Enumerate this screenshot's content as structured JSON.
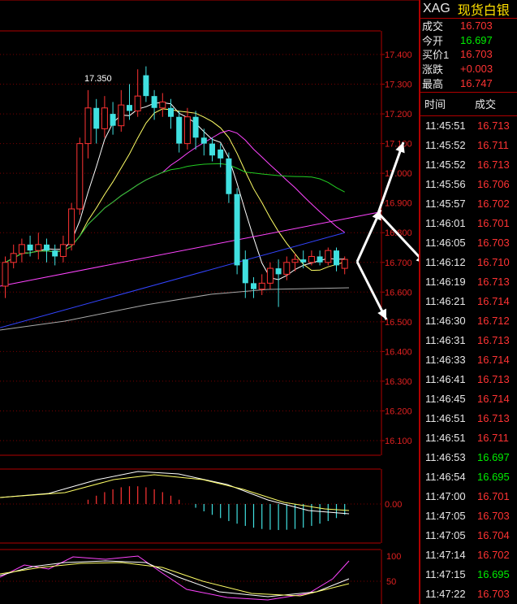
{
  "header": {
    "symbol": "XAG",
    "name": "现货白银"
  },
  "quote": [
    {
      "label": "成交",
      "value": "16.703",
      "color": "red"
    },
    {
      "label": "今开",
      "value": "16.697",
      "color": "green"
    },
    {
      "label": "买价1",
      "value": "16.703",
      "color": "red"
    },
    {
      "label": "涨跌",
      "value": "+0.003",
      "color": "red"
    },
    {
      "label": "最高",
      "value": "16.747",
      "color": "red"
    }
  ],
  "trades_header": {
    "time": "时间",
    "price": "成交"
  },
  "trades": [
    {
      "time": "11:45:51",
      "price": "16.713",
      "color": "red"
    },
    {
      "time": "11:45:52",
      "price": "16.711",
      "color": "red"
    },
    {
      "time": "11:45:52",
      "price": "16.713",
      "color": "red"
    },
    {
      "time": "11:45:56",
      "price": "16.706",
      "color": "red"
    },
    {
      "time": "11:45:57",
      "price": "16.702",
      "color": "red"
    },
    {
      "time": "11:46:01",
      "price": "16.701",
      "color": "red"
    },
    {
      "time": "11:46:05",
      "price": "16.703",
      "color": "red"
    },
    {
      "time": "11:46:12",
      "price": "16.710",
      "color": "red"
    },
    {
      "time": "11:46:19",
      "price": "16.713",
      "color": "red"
    },
    {
      "time": "11:46:21",
      "price": "16.714",
      "color": "red"
    },
    {
      "time": "11:46:30",
      "price": "16.712",
      "color": "red"
    },
    {
      "time": "11:46:31",
      "price": "16.713",
      "color": "red"
    },
    {
      "time": "11:46:33",
      "price": "16.714",
      "color": "red"
    },
    {
      "time": "11:46:41",
      "price": "16.713",
      "color": "red"
    },
    {
      "time": "11:46:45",
      "price": "16.714",
      "color": "red"
    },
    {
      "time": "11:46:51",
      "price": "16.713",
      "color": "red"
    },
    {
      "time": "11:46:51",
      "price": "16.711",
      "color": "red"
    },
    {
      "time": "11:46:53",
      "price": "16.697",
      "color": "green"
    },
    {
      "time": "11:46:54",
      "price": "16.695",
      "color": "green"
    },
    {
      "time": "11:47:00",
      "price": "16.701",
      "color": "red"
    },
    {
      "time": "11:47:05",
      "price": "16.703",
      "color": "red"
    },
    {
      "time": "11:47:05",
      "price": "16.704",
      "color": "red"
    },
    {
      "time": "11:47:14",
      "price": "16.702",
      "color": "red"
    },
    {
      "time": "11:47:15",
      "price": "16.695",
      "color": "green"
    },
    {
      "time": "11:47:22",
      "price": "16.703",
      "color": "red"
    }
  ],
  "chart_data": {
    "type": "candlestick",
    "price_axis": {
      "min": 16.1,
      "max": 17.4,
      "ticks": [
        "17.400",
        "17.300",
        "17.200",
        "17.100",
        "17.000",
        "16.900",
        "16.800",
        "16.700",
        "16.600",
        "16.500",
        "16.400",
        "16.300",
        "16.200",
        "16.100"
      ]
    },
    "high_annotation": "17.350",
    "candles": [
      {
        "o": 16.62,
        "c": 16.7,
        "h": 16.72,
        "l": 16.58
      },
      {
        "o": 16.7,
        "c": 16.73,
        "h": 16.76,
        "l": 16.68
      },
      {
        "o": 16.73,
        "c": 16.76,
        "h": 16.78,
        "l": 16.7
      },
      {
        "o": 16.76,
        "c": 16.74,
        "h": 16.79,
        "l": 16.72
      },
      {
        "o": 16.74,
        "c": 16.76,
        "h": 16.8,
        "l": 16.71
      },
      {
        "o": 16.76,
        "c": 16.74,
        "h": 16.78,
        "l": 16.7
      },
      {
        "o": 16.74,
        "c": 16.72,
        "h": 16.76,
        "l": 16.69
      },
      {
        "o": 16.72,
        "c": 16.76,
        "h": 16.79,
        "l": 16.7
      },
      {
        "o": 16.76,
        "c": 16.88,
        "h": 16.9,
        "l": 16.74
      },
      {
        "o": 16.88,
        "c": 17.1,
        "h": 17.12,
        "l": 16.86
      },
      {
        "o": 17.1,
        "c": 17.22,
        "h": 17.28,
        "l": 17.05
      },
      {
        "o": 17.22,
        "c": 17.15,
        "h": 17.25,
        "l": 17.1
      },
      {
        "o": 17.15,
        "c": 17.22,
        "h": 17.26,
        "l": 17.12
      },
      {
        "o": 17.2,
        "c": 17.16,
        "h": 17.24,
        "l": 17.13
      },
      {
        "o": 17.16,
        "c": 17.23,
        "h": 17.28,
        "l": 17.14
      },
      {
        "o": 17.23,
        "c": 17.21,
        "h": 17.3,
        "l": 17.18
      },
      {
        "o": 17.21,
        "c": 17.26,
        "h": 17.35,
        "l": 17.19
      },
      {
        "o": 17.33,
        "c": 17.26,
        "h": 17.36,
        "l": 17.24
      },
      {
        "o": 17.26,
        "c": 17.22,
        "h": 17.28,
        "l": 17.18
      },
      {
        "o": 17.22,
        "c": 17.24,
        "h": 17.27,
        "l": 17.19
      },
      {
        "o": 17.22,
        "c": 17.19,
        "h": 17.25,
        "l": 17.15
      },
      {
        "o": 17.19,
        "c": 17.1,
        "h": 17.21,
        "l": 17.07
      },
      {
        "o": 17.1,
        "c": 17.19,
        "h": 17.22,
        "l": 17.08
      },
      {
        "o": 17.19,
        "c": 17.12,
        "h": 17.21,
        "l": 17.08
      },
      {
        "o": 17.12,
        "c": 17.1,
        "h": 17.15,
        "l": 17.06
      },
      {
        "o": 17.1,
        "c": 17.06,
        "h": 17.12,
        "l": 17.04
      },
      {
        "o": 17.08,
        "c": 17.05,
        "h": 17.1,
        "l": 17.02
      },
      {
        "o": 17.05,
        "c": 16.93,
        "h": 17.07,
        "l": 16.9
      },
      {
        "o": 16.93,
        "c": 16.69,
        "h": 16.95,
        "l": 16.66
      },
      {
        "o": 16.71,
        "c": 16.63,
        "h": 16.74,
        "l": 16.58
      },
      {
        "o": 16.63,
        "c": 16.61,
        "h": 16.65,
        "l": 16.58
      },
      {
        "o": 16.61,
        "c": 16.63,
        "h": 16.66,
        "l": 16.59
      },
      {
        "o": 16.63,
        "c": 16.68,
        "h": 16.7,
        "l": 16.61
      },
      {
        "o": 16.68,
        "c": 16.66,
        "h": 16.71,
        "l": 16.55
      },
      {
        "o": 16.66,
        "c": 16.7,
        "h": 16.72,
        "l": 16.64
      },
      {
        "o": 16.7,
        "c": 16.71,
        "h": 16.73,
        "l": 16.67
      },
      {
        "o": 16.71,
        "c": 16.7,
        "h": 16.74,
        "l": 16.68
      },
      {
        "o": 16.7,
        "c": 16.72,
        "h": 16.74,
        "l": 16.69
      },
      {
        "o": 16.72,
        "c": 16.7,
        "h": 16.74,
        "l": 16.69
      },
      {
        "o": 16.7,
        "c": 16.74,
        "h": 16.75,
        "l": 16.69
      },
      {
        "o": 16.74,
        "c": 16.69,
        "h": 16.75,
        "l": 16.67
      },
      {
        "o": 16.68,
        "c": 16.71,
        "h": 16.72,
        "l": 16.66
      }
    ],
    "macd_axis_label": "0.00",
    "rsi_axis_labels": [
      "100",
      "50"
    ]
  },
  "colors": {
    "up": "#ff3333",
    "down": "#40e0e0",
    "axis": "#b00000",
    "grid": "#7a0000"
  }
}
